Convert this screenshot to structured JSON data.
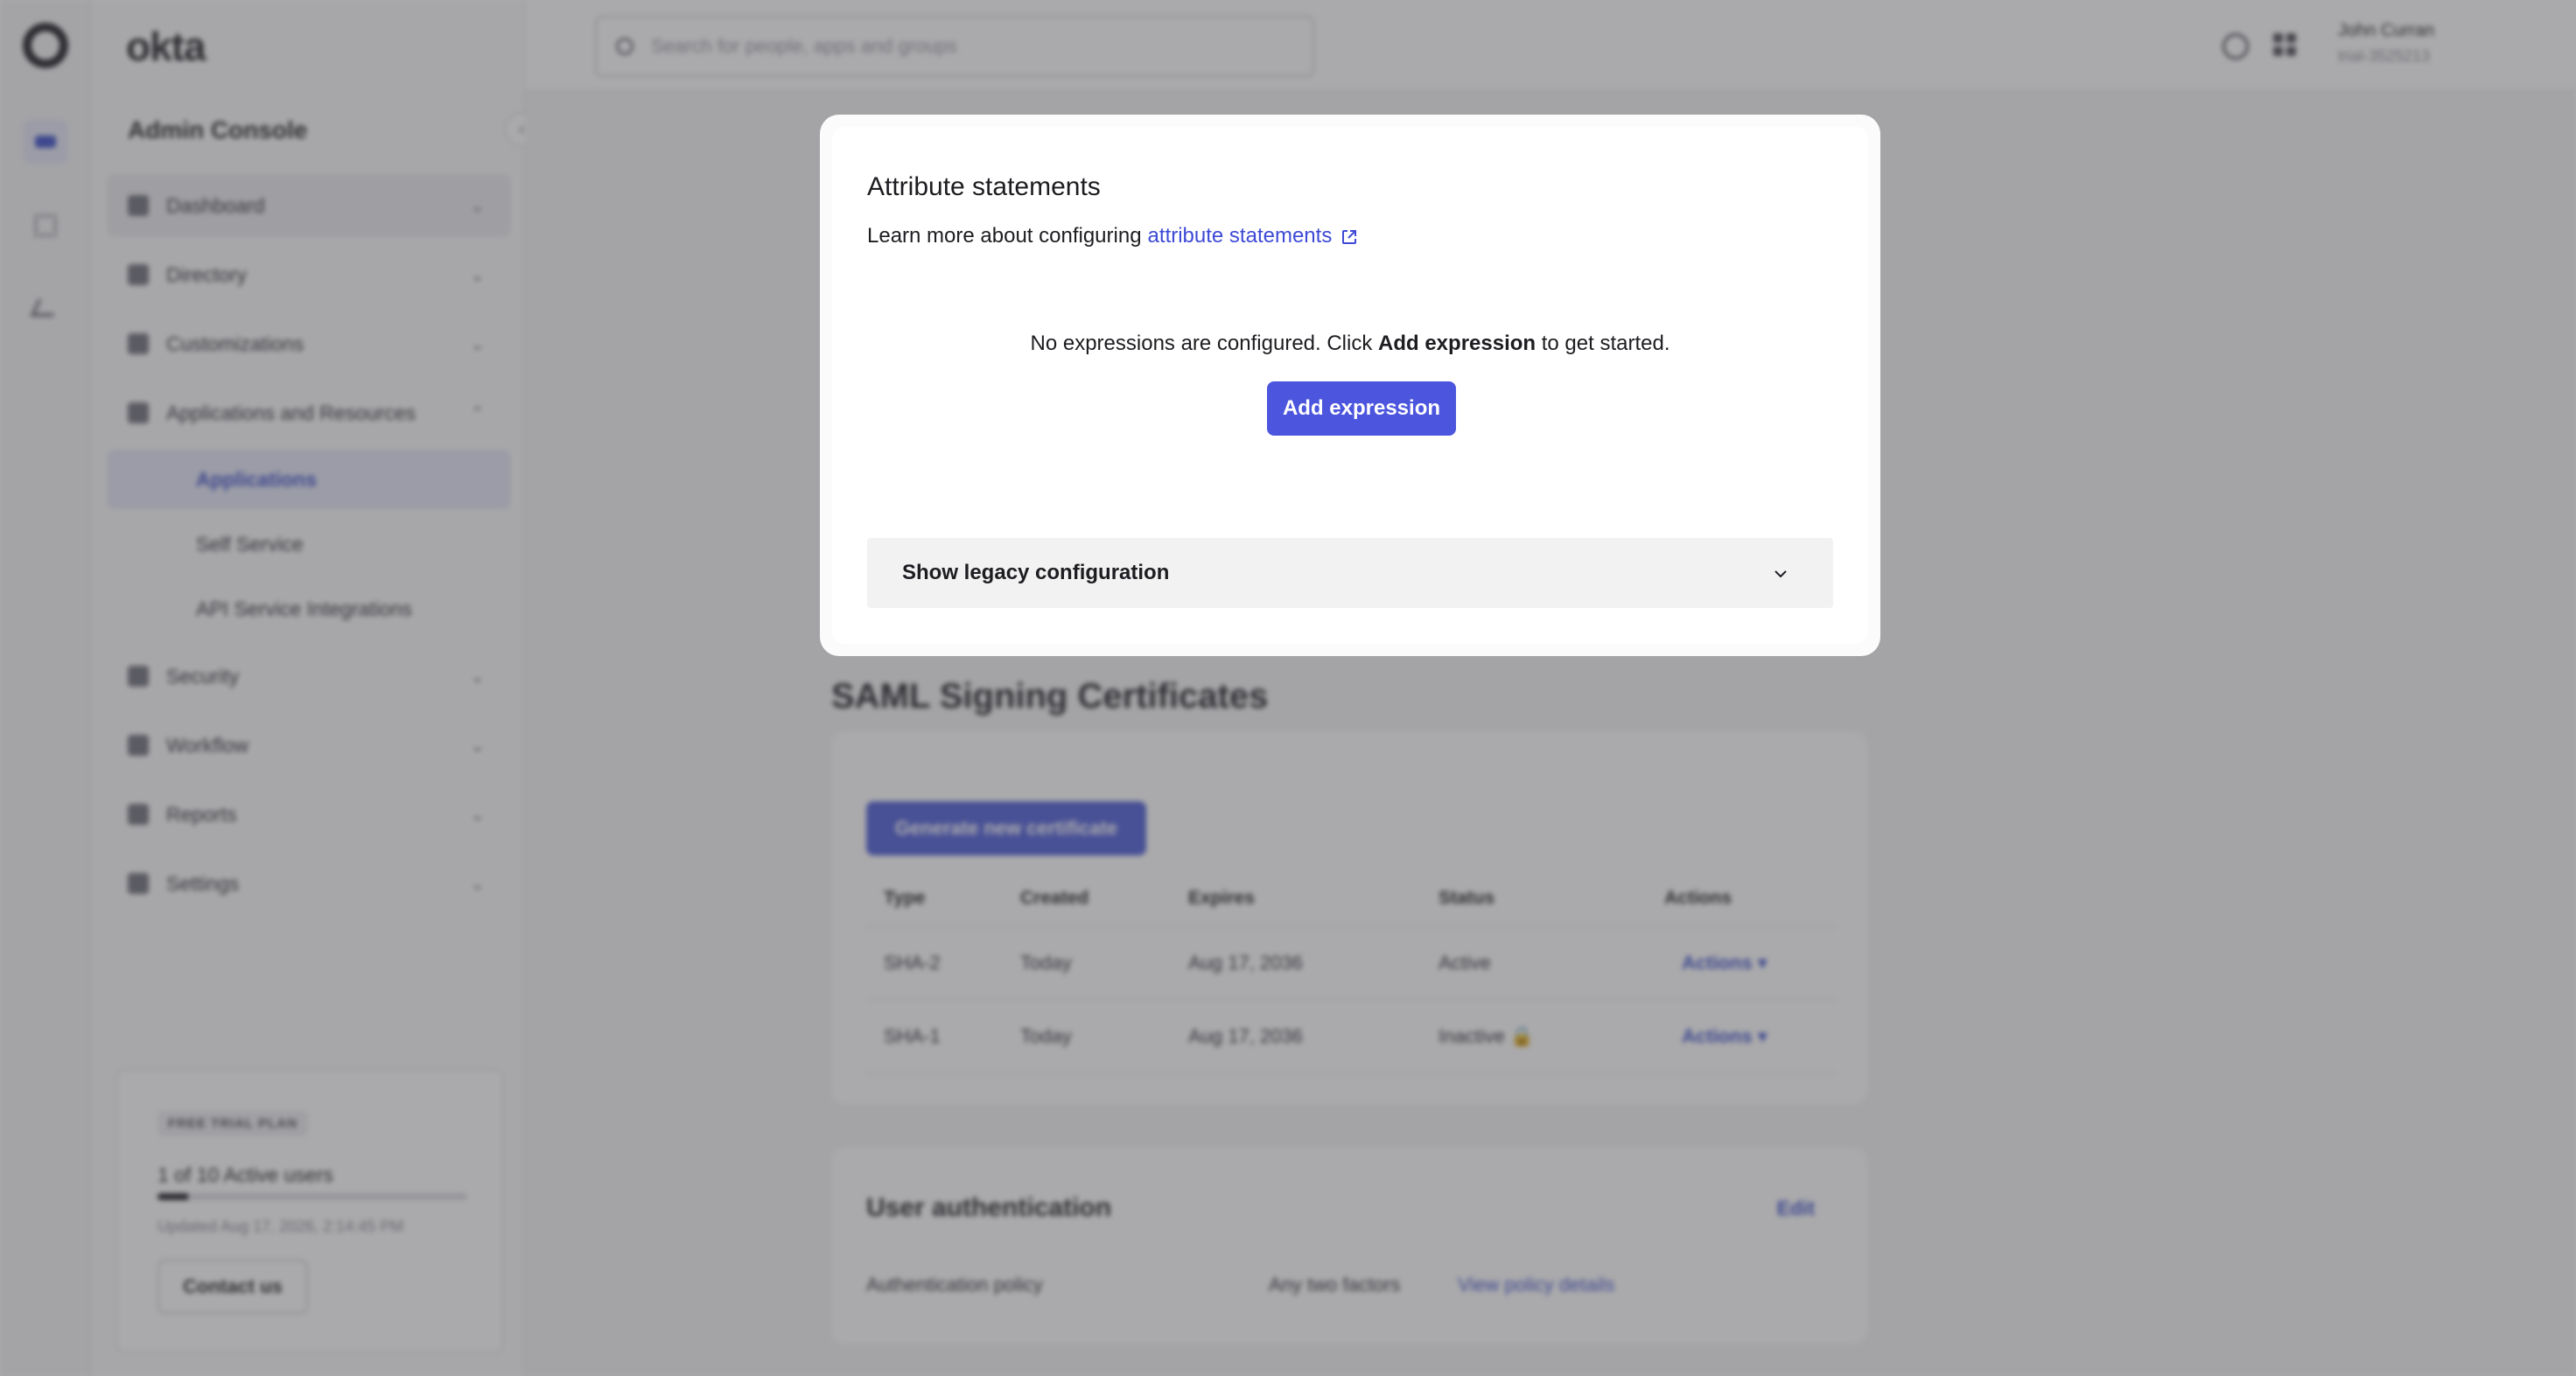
{
  "app": {
    "brand": "okta",
    "console_title": "Admin Console"
  },
  "rail": {
    "icons": [
      "okta-logo-icon",
      "admin-console-icon",
      "dashboard-grid-icon",
      "workflow-connector-icon"
    ]
  },
  "sidebar": {
    "items": [
      {
        "label": "Dashboard",
        "icon": "home-icon",
        "expanded": false
      },
      {
        "label": "Directory",
        "icon": "directory-icon",
        "expanded": false
      },
      {
        "label": "Customizations",
        "icon": "brush-icon",
        "expanded": false
      },
      {
        "label": "Applications and Resources",
        "icon": "apps-icon",
        "expanded": true
      },
      {
        "label": "Security",
        "icon": "shield-icon",
        "expanded": false
      },
      {
        "label": "Workflow",
        "icon": "workflow-icon",
        "expanded": false
      },
      {
        "label": "Reports",
        "icon": "reports-icon",
        "expanded": false
      },
      {
        "label": "Settings",
        "icon": "settings-icon",
        "expanded": false
      }
    ],
    "sub_items": [
      {
        "label": "Applications",
        "active": true
      },
      {
        "label": "Self Service",
        "active": false
      },
      {
        "label": "API Service Integrations",
        "active": false
      }
    ],
    "trial": {
      "badge": "FREE TRIAL PLAN",
      "users": "1 of 10 Active users",
      "progress": 0.1,
      "updated": "Updated Aug 17, 2026, 2:14:45 PM",
      "contact": "Contact us"
    }
  },
  "topbar": {
    "search_placeholder": "Search for people, apps and groups",
    "user_name": "John Curran",
    "user_org": "trial-3525213"
  },
  "main": {
    "saml_title": "SAML Signing Certificates",
    "generate_button": "Generate new certificate",
    "cert_headers": [
      "Type",
      "Created",
      "Expires",
      "Status",
      "Actions"
    ],
    "cert_rows": [
      {
        "type": "SHA-2",
        "created": "Today",
        "expires": "Aug 17, 2036",
        "status": "Active",
        "actions": "Actions ▾"
      },
      {
        "type": "SHA-1",
        "created": "Today",
        "expires": "Aug 17, 2036",
        "status": "Inactive 🔒",
        "actions": "Actions ▾"
      }
    ],
    "user_auth": {
      "title": "User authentication",
      "edit": "Edit",
      "policy_label": "Authentication policy",
      "policy_value": "Any two factors",
      "policy_link": "View policy details"
    }
  },
  "modal": {
    "title": "Attribute statements",
    "learn_prefix": "Learn more about configuring",
    "learn_link": "attribute statements",
    "empty_prefix": "No expressions are configured. Click",
    "empty_bold": "Add expression",
    "empty_suffix": "to get started.",
    "add_button": "Add expression",
    "legacy_label": "Show legacy configuration"
  },
  "colors": {
    "accent": "#4c55dd",
    "link": "#3e4ad6",
    "overlay": "rgba(70,70,74,0.46)"
  }
}
